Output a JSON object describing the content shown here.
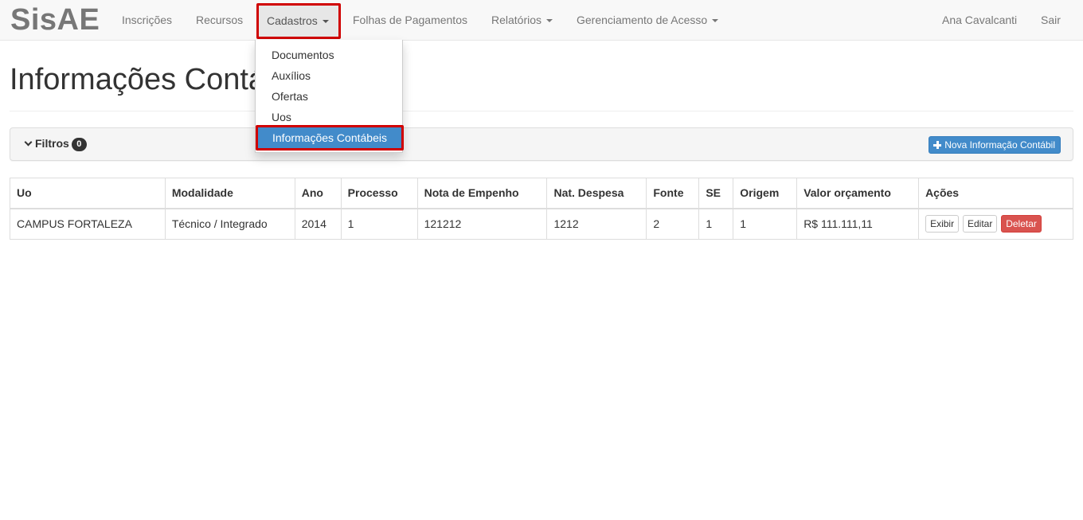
{
  "navbar": {
    "brand": "SisAE",
    "items": [
      {
        "label": "Inscrições",
        "has_caret": false
      },
      {
        "label": "Recursos",
        "has_caret": false
      },
      {
        "label": "Cadastros",
        "has_caret": true,
        "active": true
      },
      {
        "label": "Folhas de Pagamentos",
        "has_caret": false
      },
      {
        "label": "Relatórios",
        "has_caret": true
      },
      {
        "label": "Gerenciamento de Acesso",
        "has_caret": true
      }
    ],
    "user": "Ana Cavalcanti",
    "logout": "Sair"
  },
  "dropdown": {
    "items": [
      "Documentos",
      "Auxílios",
      "Ofertas",
      "Uos",
      "Informações Contábeis"
    ],
    "active_index": 4
  },
  "page": {
    "title": "Informações Contábeis"
  },
  "filters": {
    "label": "Filtros",
    "count": "0",
    "new_button": "Nova Informação Contábil"
  },
  "table": {
    "headers": [
      "Uo",
      "Modalidade",
      "Ano",
      "Processo",
      "Nota de Empenho",
      "Nat. Despesa",
      "Fonte",
      "SE",
      "Origem",
      "Valor orçamento",
      "Ações"
    ],
    "rows": [
      [
        "CAMPUS FORTALEZA",
        "Técnico / Integrado",
        "2014",
        "1",
        "121212",
        "1212",
        "2",
        "1",
        "1",
        "R$ 111.111,11"
      ]
    ],
    "actions": {
      "show": "Exibir",
      "edit": "Editar",
      "delete": "Deletar"
    }
  },
  "colors": {
    "primary": "#428bca",
    "danger": "#d9534f",
    "highlight_border": "#d00000"
  }
}
